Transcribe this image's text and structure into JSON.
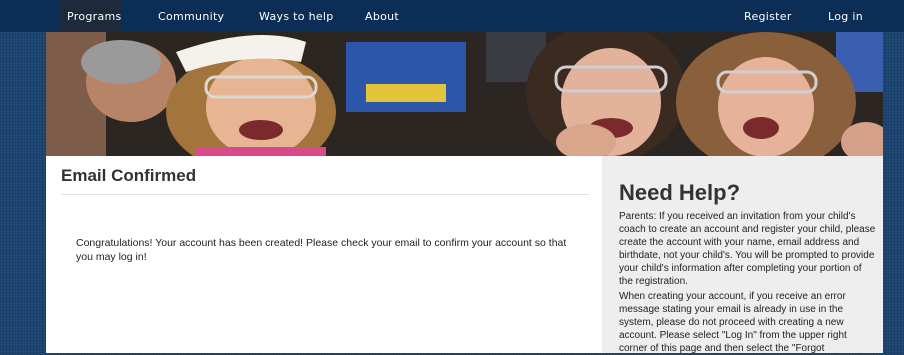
{
  "nav": {
    "left": [
      "Programs",
      "Community",
      "Ways to help",
      "About"
    ],
    "right": [
      "Register",
      "Log in"
    ]
  },
  "main": {
    "title": "Email Confirmed",
    "message": "Congratulations! Your account has been created! Please check your email to confirm your account so that you may log in!"
  },
  "sidebar": {
    "title": "Need Help?",
    "paragraphs": [
      "Parents: If you received an invitation from your child's coach to create an account and register your child, please create the account with your name, email address and birthdate, not your child's. You will be prompted to provide your child's information after completing your portion of the registration.",
      "When creating your account, if you receive an error message stating your email is already in use in the system, please do not proceed with creating a new account. Please select \"Log In\" from the upper right corner of this page and then select the \"Forgot"
    ]
  },
  "colors": {
    "nav_bg": "#0c2d55",
    "page_bg": "#1f4a78",
    "sidebar_bg": "#eeeeee"
  }
}
